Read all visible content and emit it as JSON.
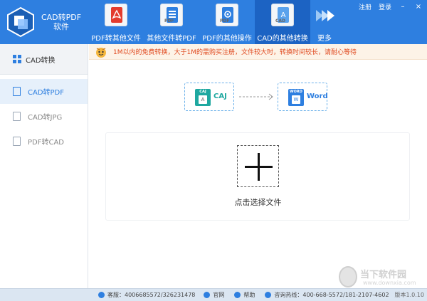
{
  "app": {
    "title_line1": "CAD转PDF",
    "title_line2": "软件"
  },
  "nav": {
    "items": [
      {
        "label": "PDF转其他文件",
        "icon": "pdf-doc-icon",
        "color": "#e33b2e"
      },
      {
        "label": "其他文件转PDF",
        "icon": "doc-to-pdf-icon",
        "color": "#2e7fe0"
      },
      {
        "label": "PDF的其他操作",
        "icon": "pdf-gear-icon",
        "color": "#2e7fe0"
      },
      {
        "label": "CAD的其他转换",
        "icon": "cad-doc-icon",
        "color": "#2e7fe0"
      }
    ],
    "active_index": 3,
    "more_label": "更多"
  },
  "top_links": {
    "register": "注册",
    "login": "登录"
  },
  "sidebar": {
    "header": "CAD转换",
    "items": [
      {
        "label": "CAD转PDF"
      },
      {
        "label": "CAD转JPG"
      },
      {
        "label": "PDF转CAD"
      }
    ],
    "active_index": 0
  },
  "notice": {
    "text": "1M以内的免费转换，大于1M的需购买注册，文件较大时，转换时间较长，请耐心等待"
  },
  "conversion": {
    "from_label": "CAJ",
    "from_badge": "CAJ",
    "to_label": "Word",
    "to_badge": "WORD",
    "from_color": "#1fa8a0",
    "to_color": "#2e7fe0"
  },
  "upload": {
    "label": "点击选择文件"
  },
  "footer": {
    "service": "客服：4006685572/326231478",
    "website": "官网",
    "help": "帮助",
    "hotline": "咨询热线：400-668-5572/181-2107-4602",
    "version": "版本1.0.10"
  },
  "watermark": {
    "text": "当下软件园",
    "url": "www.downxia.com"
  },
  "colors": {
    "header": "#2e7fe0",
    "active_nav": "#1c63c3",
    "notice_text": "#e0491f"
  }
}
